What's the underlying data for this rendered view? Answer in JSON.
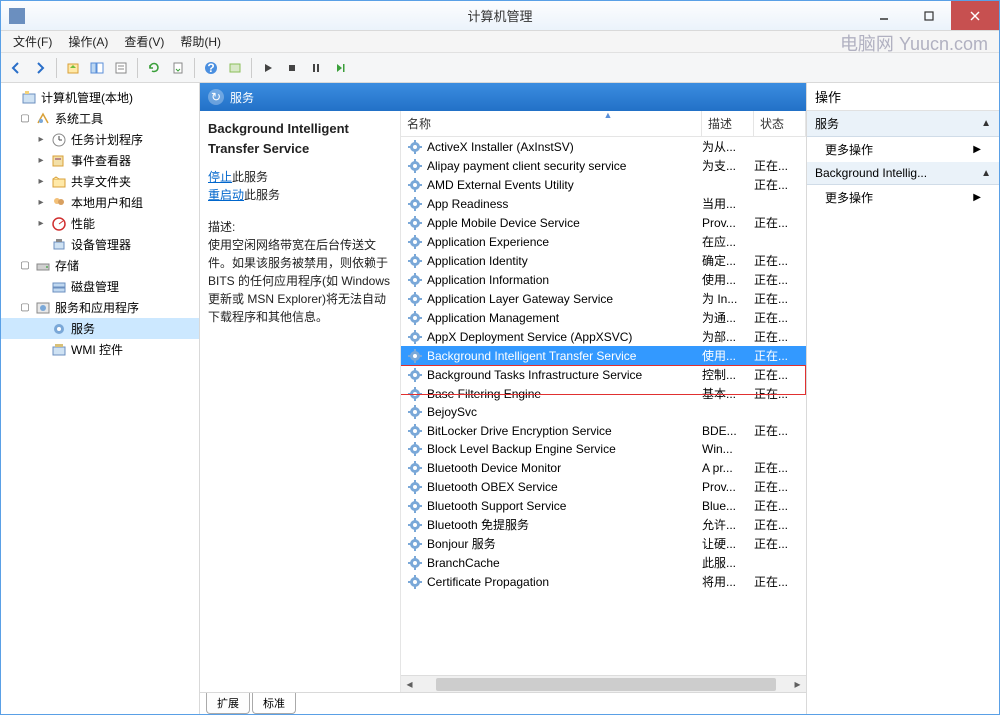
{
  "window": {
    "title": "计算机管理"
  },
  "menu": {
    "file": "文件(F)",
    "action": "操作(A)",
    "view": "查看(V)",
    "help": "帮助(H)"
  },
  "tree": {
    "root": "计算机管理(本地)",
    "systools": "系统工具",
    "task": "任务计划程序",
    "event": "事件查看器",
    "share": "共享文件夹",
    "users": "本地用户和组",
    "perf": "性能",
    "devmgr": "设备管理器",
    "storage": "存储",
    "disk": "磁盘管理",
    "apps": "服务和应用程序",
    "services": "服务",
    "wmi": "WMI 控件"
  },
  "center": {
    "header": "服务",
    "selected_name": "Background Intelligent Transfer Service",
    "stop_prefix": "停止",
    "stop_suffix": "此服务",
    "restart_prefix": "重启动",
    "restart_suffix": "此服务",
    "desc_label": "描述:",
    "desc_text": "使用空闲网络带宽在后台传送文件。如果该服务被禁用，则依赖于 BITS 的任何应用程序(如 Windows 更新或 MSN Explorer)将无法自动下载程序和其他信息。",
    "col_name": "名称",
    "col_desc": "描述",
    "col_stat": "状态",
    "tab_ext": "扩展",
    "tab_std": "标准"
  },
  "services": [
    {
      "name": "ActiveX Installer (AxInstSV)",
      "desc": "为从...",
      "stat": ""
    },
    {
      "name": "Alipay payment client security service",
      "desc": "为支...",
      "stat": "正在..."
    },
    {
      "name": "AMD External Events Utility",
      "desc": "",
      "stat": "正在..."
    },
    {
      "name": "App Readiness",
      "desc": "当用...",
      "stat": ""
    },
    {
      "name": "Apple Mobile Device Service",
      "desc": "Prov...",
      "stat": "正在..."
    },
    {
      "name": "Application Experience",
      "desc": "在应...",
      "stat": ""
    },
    {
      "name": "Application Identity",
      "desc": "确定...",
      "stat": "正在..."
    },
    {
      "name": "Application Information",
      "desc": "使用...",
      "stat": "正在..."
    },
    {
      "name": "Application Layer Gateway Service",
      "desc": "为 In...",
      "stat": "正在..."
    },
    {
      "name": "Application Management",
      "desc": "为通...",
      "stat": "正在..."
    },
    {
      "name": "AppX Deployment Service (AppXSVC)",
      "desc": "为部...",
      "stat": "正在..."
    },
    {
      "name": "Background Intelligent Transfer Service",
      "desc": "使用...",
      "stat": "正在..."
    },
    {
      "name": "Background Tasks Infrastructure Service",
      "desc": "控制...",
      "stat": "正在..."
    },
    {
      "name": "Base Filtering Engine",
      "desc": "基本...",
      "stat": "正在..."
    },
    {
      "name": "BejoySvc",
      "desc": "",
      "stat": ""
    },
    {
      "name": "BitLocker Drive Encryption Service",
      "desc": "BDE...",
      "stat": "正在..."
    },
    {
      "name": "Block Level Backup Engine Service",
      "desc": "Win...",
      "stat": ""
    },
    {
      "name": "Bluetooth Device Monitor",
      "desc": "A pr...",
      "stat": "正在..."
    },
    {
      "name": "Bluetooth OBEX Service",
      "desc": "Prov...",
      "stat": "正在..."
    },
    {
      "name": "Bluetooth Support Service",
      "desc": "Blue...",
      "stat": "正在..."
    },
    {
      "name": "Bluetooth 免提服务",
      "desc": "允许...",
      "stat": "正在..."
    },
    {
      "name": "Bonjour 服务",
      "desc": "让硬...",
      "stat": "正在..."
    },
    {
      "name": "BranchCache",
      "desc": "此服...",
      "stat": ""
    },
    {
      "name": "Certificate Propagation",
      "desc": "将用...",
      "stat": "正在..."
    }
  ],
  "actions": {
    "title": "操作",
    "section1": "服务",
    "more": "更多操作",
    "section2": "Background Intellig..."
  },
  "watermark": "电脑网 Yuucn.com"
}
